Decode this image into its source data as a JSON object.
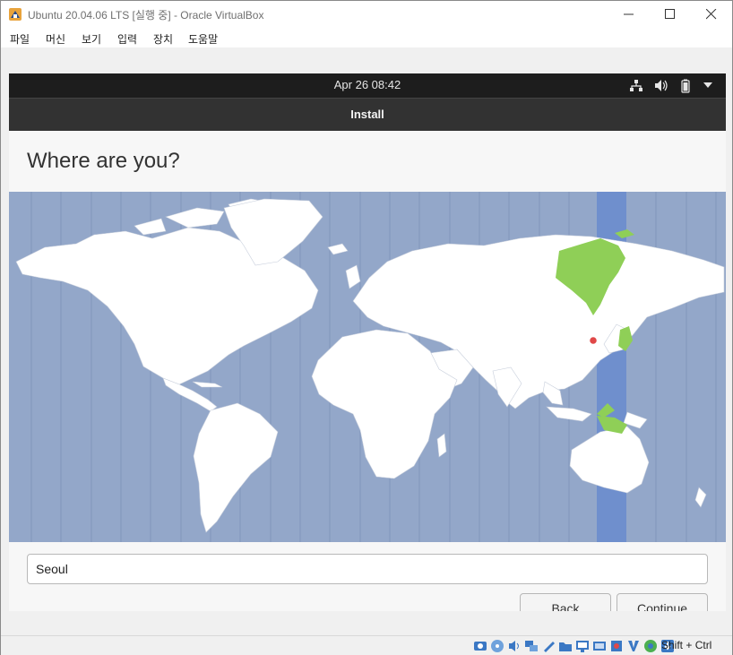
{
  "window": {
    "title": "Ubuntu 20.04.06 LTS [실행 중] - Oracle VirtualBox",
    "menu": [
      "파일",
      "머신",
      "보기",
      "입력",
      "장치",
      "도움말"
    ]
  },
  "topbar": {
    "clock": "Apr 26  08:42"
  },
  "installer": {
    "header_title": "Install",
    "heading": "Where are you?",
    "location_value": "Seoul",
    "back_label": "Back",
    "continue_label": "Continue"
  },
  "status": {
    "host_key": "Shift + Ctrl"
  },
  "colors": {
    "ocean": "#93a7c9",
    "selected_zone": "#6f8fcd",
    "highlight_land": "#8fcf57",
    "topbar": "#1d1d1d",
    "header": "#323232"
  }
}
